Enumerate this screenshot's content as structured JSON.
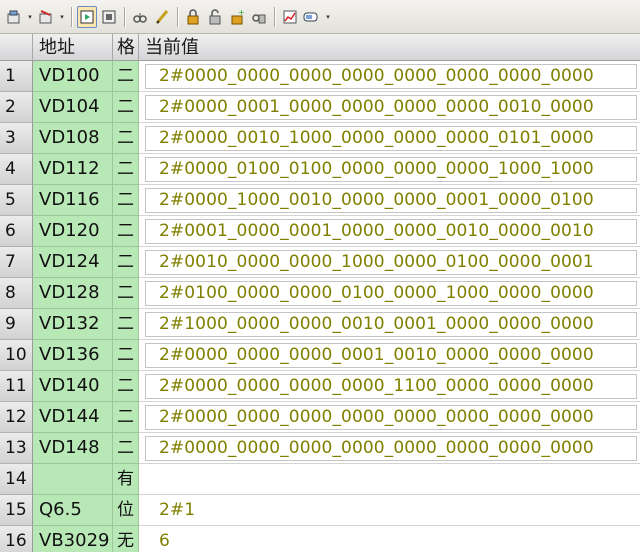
{
  "toolbar": {
    "icons": [
      "insert-row-icon",
      "delete-row-icon",
      "trend-view-icon",
      "table-view-icon",
      "read-icon",
      "write-icon",
      "force-icon",
      "unforce-icon",
      "read-all-forced-icon",
      "unforce-all-icon",
      "chart-icon",
      "display-format-icon"
    ]
  },
  "header": {
    "address": "地址",
    "format": "格",
    "current_value": "当前值"
  },
  "rows": [
    {
      "num": "1",
      "address": "VD100",
      "format": "二",
      "value": "2#0000_0000_0000_0000_0000_0000_0000_0000"
    },
    {
      "num": "2",
      "address": "VD104",
      "format": "二",
      "value": "2#0000_0001_0000_0000_0000_0000_0010_0000"
    },
    {
      "num": "3",
      "address": "VD108",
      "format": "二",
      "value": "2#0000_0010_1000_0000_0000_0000_0101_0000"
    },
    {
      "num": "4",
      "address": "VD112",
      "format": "二",
      "value": "2#0000_0100_0100_0000_0000_0000_1000_1000"
    },
    {
      "num": "5",
      "address": "VD116",
      "format": "二",
      "value": "2#0000_1000_0010_0000_0000_0001_0000_0100"
    },
    {
      "num": "6",
      "address": "VD120",
      "format": "二",
      "value": "2#0001_0000_0001_0000_0000_0010_0000_0010"
    },
    {
      "num": "7",
      "address": "VD124",
      "format": "二",
      "value": "2#0010_0000_0000_1000_0000_0100_0000_0001"
    },
    {
      "num": "8",
      "address": "VD128",
      "format": "二",
      "value": "2#0100_0000_0000_0100_0000_1000_0000_0000"
    },
    {
      "num": "9",
      "address": "VD132",
      "format": "二",
      "value": "2#1000_0000_0000_0010_0001_0000_0000_0000"
    },
    {
      "num": "10",
      "address": "VD136",
      "format": "二",
      "value": "2#0000_0000_0000_0001_0010_0000_0000_0000"
    },
    {
      "num": "11",
      "address": "VD140",
      "format": "二",
      "value": "2#0000_0000_0000_0000_1100_0000_0000_0000"
    },
    {
      "num": "12",
      "address": "VD144",
      "format": "二",
      "value": "2#0000_0000_0000_0000_0000_0000_0000_0000"
    },
    {
      "num": "13",
      "address": "VD148",
      "format": "二",
      "value": "2#0000_0000_0000_0000_0000_0000_0000_0000"
    },
    {
      "num": "14",
      "address": "",
      "format": "有",
      "value": ""
    },
    {
      "num": "15",
      "address": "Q6.5",
      "format": "位",
      "value": "2#1"
    },
    {
      "num": "16",
      "address": "VB3029",
      "format": "无",
      "value": "6"
    }
  ]
}
